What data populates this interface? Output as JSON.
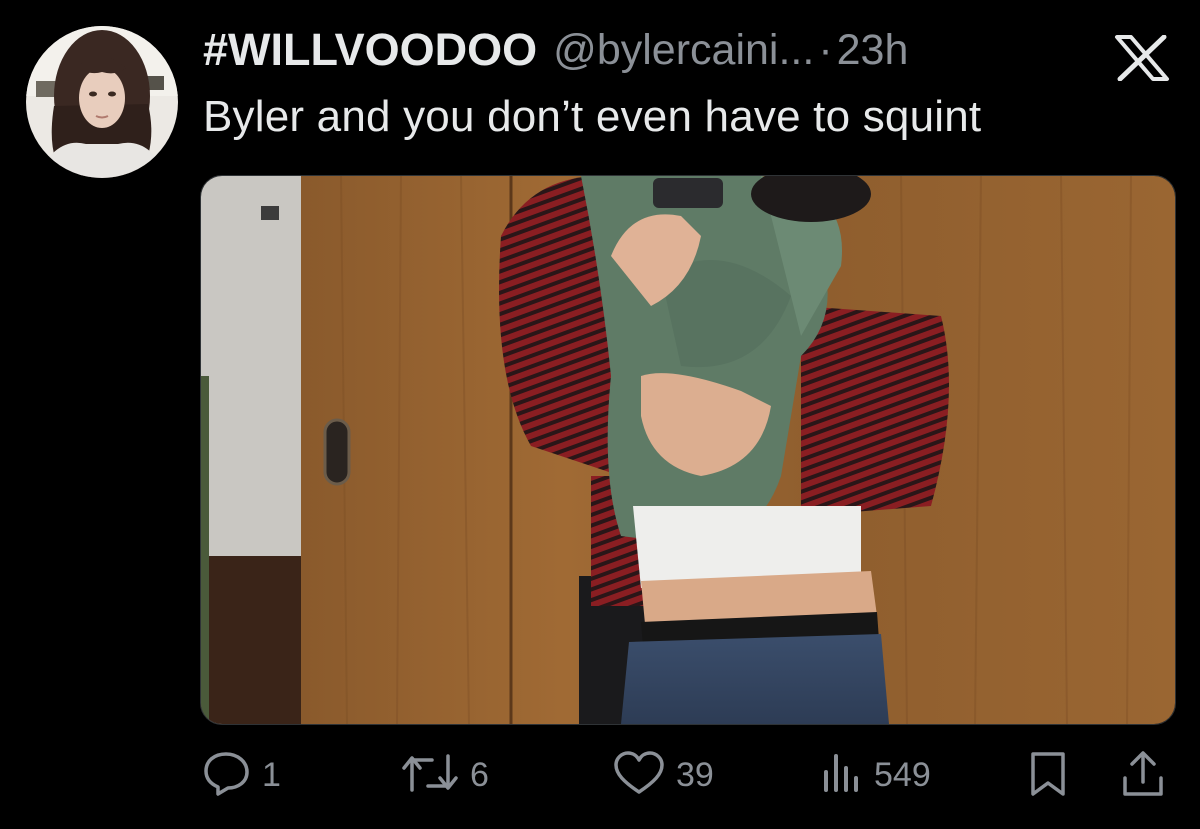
{
  "author": {
    "display_name": "#WILLVOODOO",
    "handle": "@bylercaini...",
    "separator": "·",
    "time": "23h"
  },
  "tweet": {
    "text": "Byler and you don’t even have to squint"
  },
  "actions": {
    "replies": "1",
    "reposts": "6",
    "likes": "39",
    "views": "549"
  },
  "icons": {
    "platform_logo": "x-logo-icon",
    "reply": "speech-bubble-icon",
    "repost": "repost-arrows-icon",
    "like": "heart-icon",
    "views": "bar-chart-icon",
    "bookmark": "bookmark-icon",
    "share": "share-upload-icon"
  },
  "colors": {
    "background": "#000000",
    "primary_text": "#e7e9ea",
    "secondary_text": "#8b9097"
  }
}
